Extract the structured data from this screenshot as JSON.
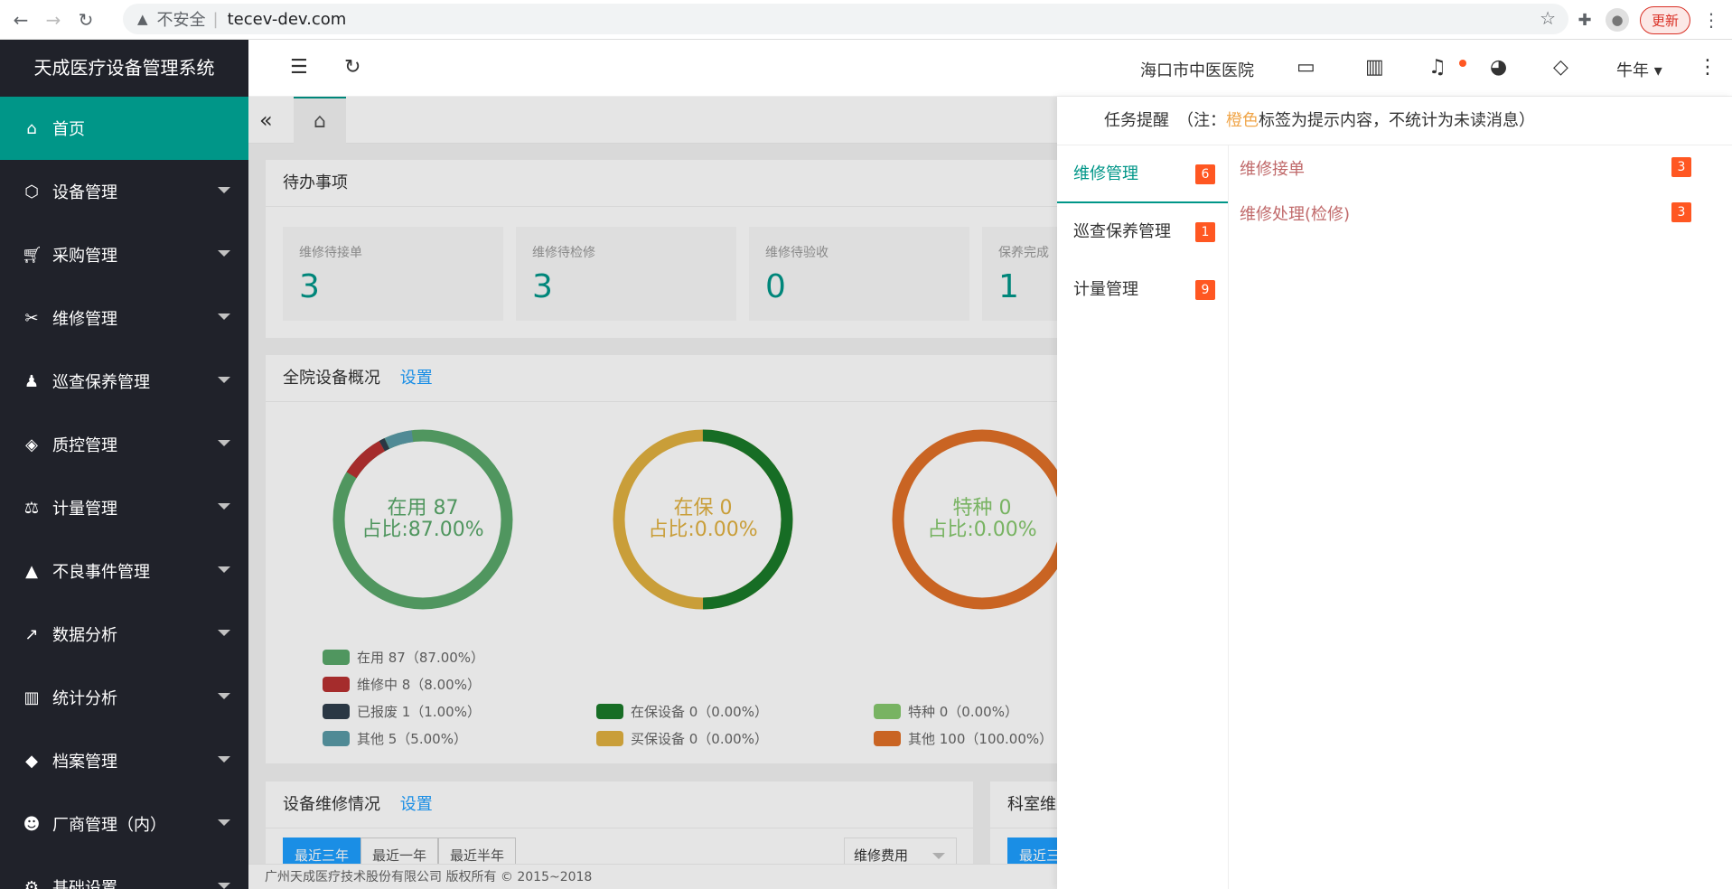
{
  "browser": {
    "insecure_label": "不安全",
    "url": "tecev-dev.com",
    "update_label": "更新"
  },
  "sidebar": {
    "title": "天成医疗设备管理系统",
    "items": [
      {
        "label": "首页",
        "icon": "home-icon"
      },
      {
        "label": "设备管理",
        "icon": "box-icon"
      },
      {
        "label": "采购管理",
        "icon": "cart-icon"
      },
      {
        "label": "维修管理",
        "icon": "wrench-icon"
      },
      {
        "label": "巡查保养管理",
        "icon": "inspect-icon"
      },
      {
        "label": "质控管理",
        "icon": "shield-icon"
      },
      {
        "label": "计量管理",
        "icon": "scale-icon"
      },
      {
        "label": "不良事件管理",
        "icon": "warning-icon"
      },
      {
        "label": "数据分析",
        "icon": "line-chart-icon"
      },
      {
        "label": "统计分析",
        "icon": "bar-chart-icon"
      },
      {
        "label": "档案管理",
        "icon": "layers-icon"
      },
      {
        "label": "厂商管理（内）",
        "icon": "people-icon"
      },
      {
        "label": "基础设置",
        "icon": "gear-icon"
      }
    ]
  },
  "header": {
    "hospital": "海口市中医医院",
    "user": "牛年"
  },
  "todo": {
    "title": "待办事项",
    "stats": [
      {
        "label": "维修待接单",
        "value": "3"
      },
      {
        "label": "维修待检修",
        "value": "3"
      },
      {
        "label": "维修待验收",
        "value": "0"
      },
      {
        "label": "保养完成",
        "value": "1"
      }
    ]
  },
  "overview": {
    "title": "全院设备概况",
    "settings_link": "设置",
    "donuts": [
      {
        "center_line1": "在用 87",
        "center_line2": "占比:87.00%",
        "center_color": "#5aa86a"
      },
      {
        "center_line1": "在保 0",
        "center_line2": "占比:0.00%",
        "center_color": "#e0b040"
      },
      {
        "center_line1": "特种 0",
        "center_line2": "占比:0.00%",
        "center_color": "#86c86e"
      }
    ],
    "legend1": [
      {
        "label": "在用 87（87.00%）",
        "color": "#5aa86a"
      },
      {
        "label": "维修中 8（8.00%）",
        "color": "#b83232"
      },
      {
        "label": "已报废 1（1.00%）",
        "color": "#2f3e4c"
      },
      {
        "label": "其他 5（5.00%）",
        "color": "#5a9aa6"
      }
    ],
    "legend2": [
      {
        "label": "在保设备 0（0.00%）",
        "color": "#1a7a2a"
      },
      {
        "label": "买保设备 0（0.00%）",
        "color": "#e0b040"
      }
    ],
    "legend3": [
      {
        "label": "特种 0（0.00%）",
        "color": "#86c86e"
      },
      {
        "label": "其他 100（100.00%）",
        "color": "#e07028"
      }
    ]
  },
  "repair": {
    "title": "设备维修情况",
    "settings_link": "设置",
    "buttons": [
      "最近三年",
      "最近一年",
      "最近半年"
    ],
    "select_value": "维修费用"
  },
  "dept": {
    "title": "科室维",
    "button": "最近三"
  },
  "footer": {
    "text": "广州天成医疗技术股份有限公司 版权所有 © 2015~2018"
  },
  "panel": {
    "head_prefix": "任务提醒　（注：",
    "head_orange": "橙色",
    "head_suffix": "标签为提示内容，不统计为未读消息）",
    "tabs": [
      {
        "label": "维修管理",
        "count": "6"
      },
      {
        "label": "巡查保养管理",
        "count": "1"
      },
      {
        "label": "计量管理",
        "count": "9"
      }
    ],
    "items": [
      {
        "label": "维修接单",
        "count": "3"
      },
      {
        "label": "维修处理(检修)",
        "count": "3"
      }
    ]
  }
}
